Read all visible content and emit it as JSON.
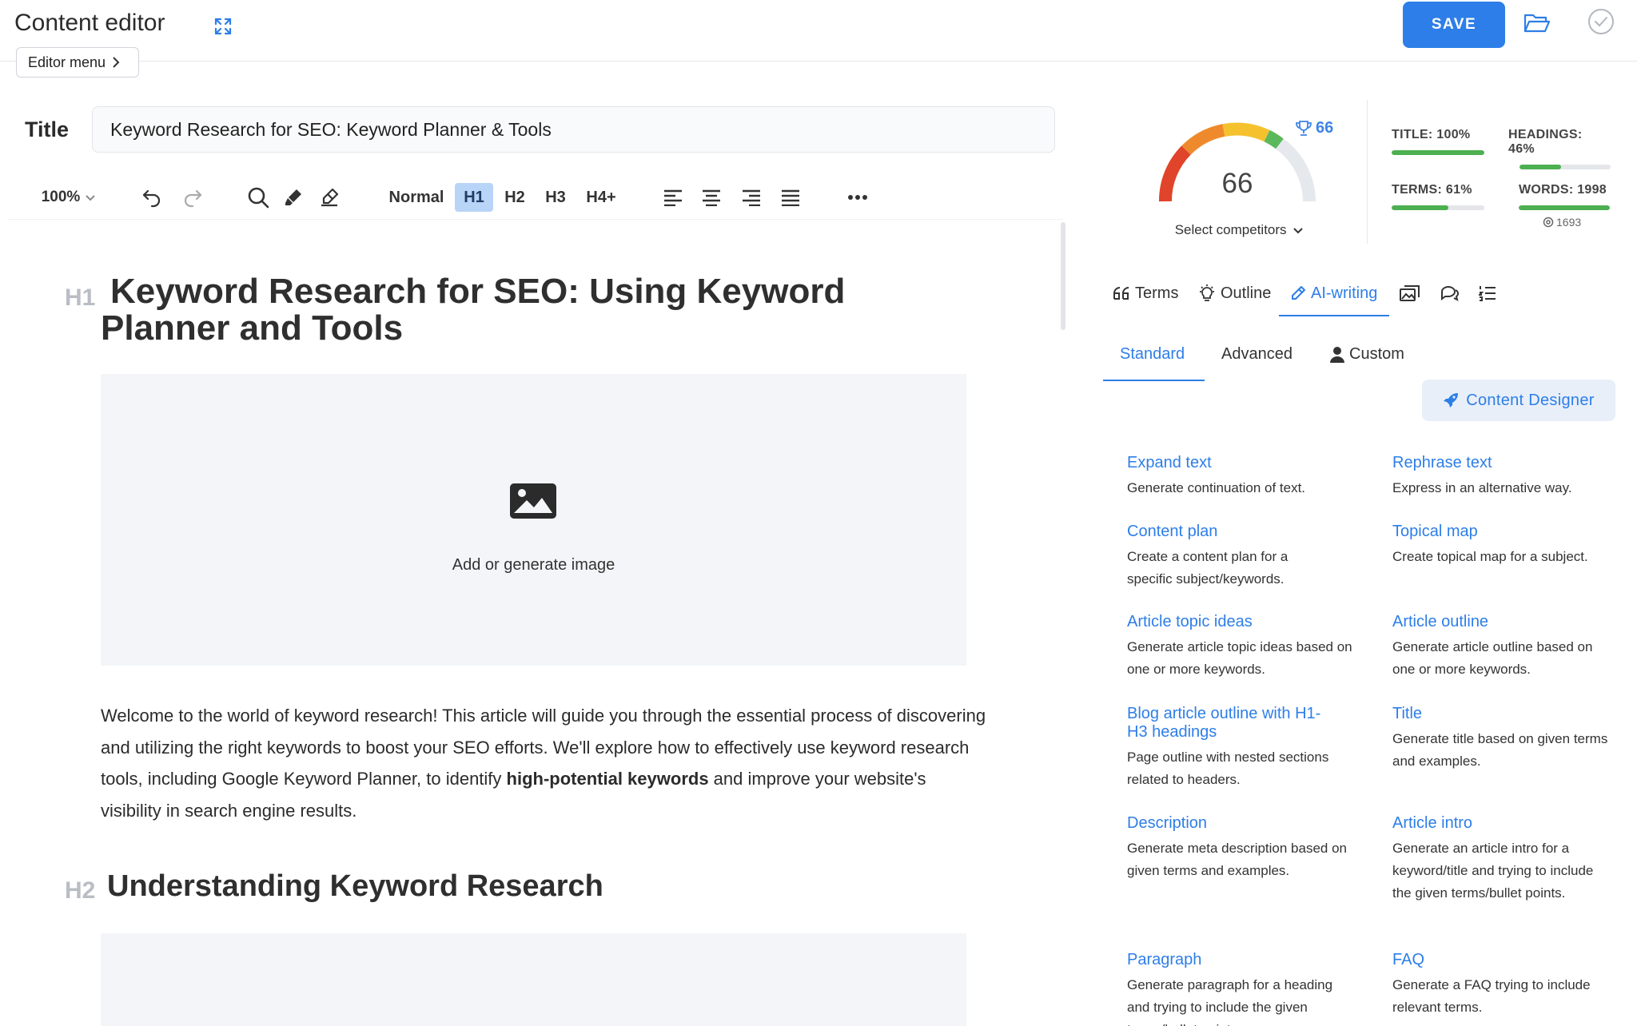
{
  "header": {
    "app_title": "Content editor",
    "save_label": "SAVE",
    "editor_menu_label": "Editor menu"
  },
  "title_field": {
    "label": "Title",
    "value": "Keyword Research for SEO: Keyword Planner & Tools"
  },
  "toolbar": {
    "zoom": "100%",
    "headings": [
      {
        "label": "Normal",
        "active": false
      },
      {
        "label": "H1",
        "active": true
      },
      {
        "label": "H2",
        "active": false
      },
      {
        "label": "H3",
        "active": false
      },
      {
        "label": "H4+",
        "active": false
      }
    ]
  },
  "editor": {
    "h1_tag": "H1",
    "h1_text": "Keyword Research for SEO: Using Keyword Planner and Tools",
    "image_caption": "Add or generate image",
    "paragraph_parts": [
      "Welcome to the world of keyword research! This article will guide you through the essential process of discovering and utilizing the right keywords to boost your SEO efforts. We'll explore how to effectively use keyword research tools, including Google Keyword Planner, to identify ",
      "high-potential keywords",
      " and improve your website's visibility in search engine results."
    ],
    "h2_tag": "H2",
    "h2_text": "Understanding Keyword Research"
  },
  "score": {
    "value": "66",
    "competitor_top": "66",
    "select_competitors": "Select competitors",
    "metrics": [
      {
        "label": "TITLE: 100%",
        "fill": 1.0
      },
      {
        "label": "HEADINGS: 46%",
        "fill": 0.46
      },
      {
        "label": "TERMS: 61%",
        "fill": 0.61
      },
      {
        "label": "WORDS: 1998",
        "fill": 1.0
      }
    ],
    "competitor_words": "1693"
  },
  "tabs": [
    {
      "label": "Terms",
      "icon": "quote-icon",
      "active": false
    },
    {
      "label": "Outline",
      "icon": "lightbulb-icon",
      "active": false
    },
    {
      "label": "AI-writing",
      "icon": "pen-icon",
      "active": true
    }
  ],
  "subtabs": [
    {
      "label": "Standard",
      "active": true
    },
    {
      "label": "Advanced",
      "active": false
    },
    {
      "label": "Custom",
      "active": false
    }
  ],
  "content_designer_label": "Content Designer",
  "templates": [
    {
      "title": "Expand text",
      "desc": "Generate continuation of text."
    },
    {
      "title": "Rephrase text",
      "desc": "Express in an alternative way."
    },
    {
      "title": "Content plan",
      "desc": "Create a content plan for a specific subject/keywords."
    },
    {
      "title": "Topical map",
      "desc": "Create topical map for a subject."
    },
    {
      "title": "Article topic ideas",
      "desc": "Generate article topic ideas based on one or more keywords."
    },
    {
      "title": "Article outline",
      "desc": "Generate article outline based on one or more keywords."
    },
    {
      "title": "Blog article outline with H1-H3 headings",
      "desc": "Page outline with nested sections related to headers."
    },
    {
      "title": "Title",
      "desc": "Generate title based on given terms and examples."
    },
    {
      "title": "Description",
      "desc": "Generate meta description based on given terms and examples."
    },
    {
      "title": "Article intro",
      "desc": "Generate an article intro for a keyword/title and trying to include the given terms/bullet points."
    },
    {
      "title": "Paragraph",
      "desc": "Generate paragraph for a heading and trying to include the given terms/bullet points."
    },
    {
      "title": "FAQ",
      "desc": "Generate a FAQ trying to include relevant terms."
    }
  ],
  "colors": {
    "accent": "#2d7ee8",
    "active_heading_bg": "#b8d4f7",
    "progress": "#4caf50",
    "gauge": [
      "#e0442a",
      "#ee8a2c",
      "#f5c22e",
      "#5cb85c",
      "#e5e8ec"
    ]
  }
}
